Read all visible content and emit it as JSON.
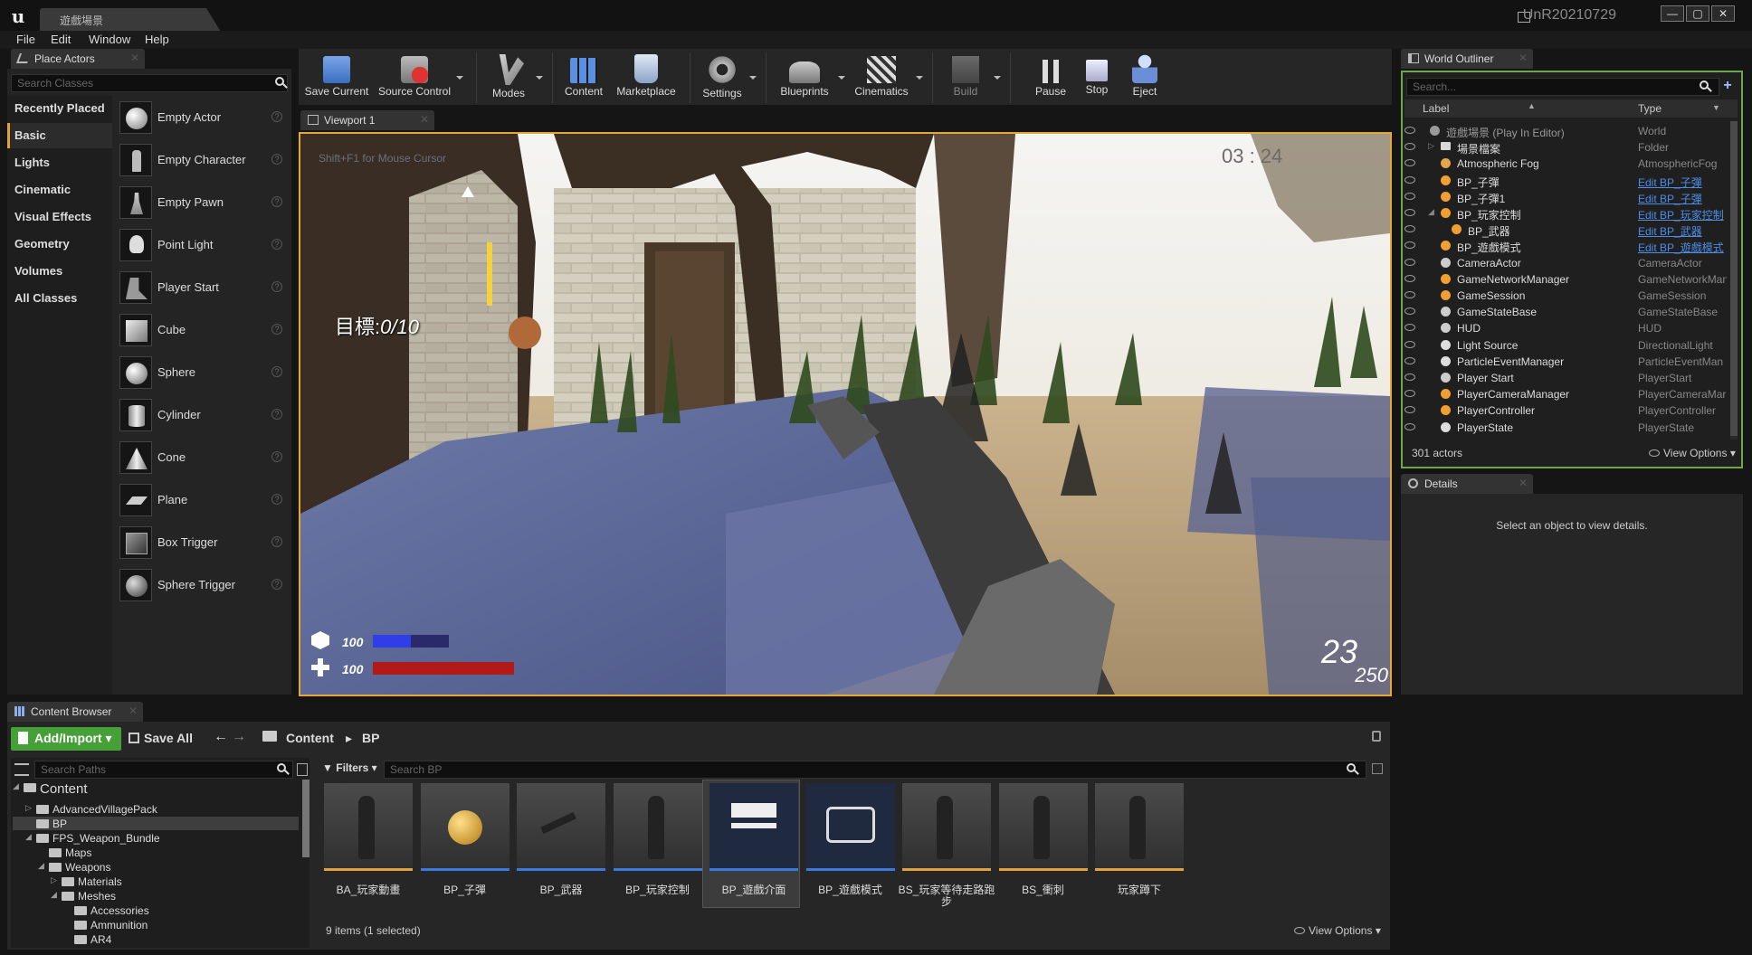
{
  "window": {
    "doc_tab": "遊戲場景",
    "project": "UnR20210729",
    "controls": [
      "—",
      "▢",
      "✕"
    ]
  },
  "menu": [
    "File",
    "Edit",
    "Window",
    "Help"
  ],
  "place_actors": {
    "tab": "Place Actors",
    "search_placeholder": "Search Classes",
    "categories": [
      "Recently Placed",
      "Basic",
      "Lights",
      "Cinematic",
      "Visual Effects",
      "Geometry",
      "Volumes",
      "All Classes"
    ],
    "active_category": "Basic",
    "actors": [
      "Empty Actor",
      "Empty Character",
      "Empty Pawn",
      "Point Light",
      "Player Start",
      "Cube",
      "Sphere",
      "Cylinder",
      "Cone",
      "Plane",
      "Box Trigger",
      "Sphere Trigger"
    ]
  },
  "toolbar": {
    "save_current": "Save Current",
    "source_control": "Source Control",
    "modes": "Modes",
    "content": "Content",
    "marketplace": "Marketplace",
    "settings": "Settings",
    "blueprints": "Blueprints",
    "cinematics": "Cinematics",
    "build": "Build",
    "pause": "Pause",
    "stop": "Stop",
    "eject": "Eject"
  },
  "viewport": {
    "tab": "Viewport 1",
    "hint": "Shift+F1 for Mouse Cursor",
    "timer": "03 : 24",
    "goal_label": "目標:",
    "goal_value": "0/10",
    "armor": "100",
    "health": "100",
    "ammo": "23",
    "ammo_total": "250",
    "armor_fill": 0.5,
    "health_fill": 1.0
  },
  "world_outliner": {
    "tab": "World Outliner",
    "search_placeholder": "Search...",
    "col_label": "Label",
    "col_type": "Type",
    "rows": [
      {
        "label": "遊戲場景 (Play In Editor)",
        "type": "World",
        "link": false,
        "indent": 0,
        "icon": "#9a9a9a"
      },
      {
        "label": "場景檔案",
        "type": "Folder",
        "link": false,
        "indent": 1,
        "icon": "#d8d8d8"
      },
      {
        "label": "Atmospheric Fog",
        "type": "AtmosphericFog",
        "link": false,
        "indent": 1,
        "icon": "#e3a64a"
      },
      {
        "label": "BP_子彈",
        "type": "Edit BP_子彈",
        "link": true,
        "indent": 1,
        "icon": "#f0a030"
      },
      {
        "label": "BP_子彈1",
        "type": "Edit BP_子彈",
        "link": true,
        "indent": 1,
        "icon": "#f0a030"
      },
      {
        "label": "BP_玩家控制",
        "type": "Edit BP_玩家控制",
        "link": true,
        "indent": 1,
        "icon": "#f0a030"
      },
      {
        "label": "BP_武器",
        "type": "Edit BP_武器",
        "link": true,
        "indent": 2,
        "icon": "#f0a030"
      },
      {
        "label": "BP_遊戲模式",
        "type": "Edit BP_遊戲模式",
        "link": true,
        "indent": 1,
        "icon": "#f0a030"
      },
      {
        "label": "CameraActor",
        "type": "CameraActor",
        "link": false,
        "indent": 1,
        "icon": "#cccccc"
      },
      {
        "label": "GameNetworkManager",
        "type": "GameNetworkMan",
        "link": false,
        "indent": 1,
        "icon": "#f0a030"
      },
      {
        "label": "GameSession",
        "type": "GameSession",
        "link": false,
        "indent": 1,
        "icon": "#f0a030"
      },
      {
        "label": "GameStateBase",
        "type": "GameStateBase",
        "link": false,
        "indent": 1,
        "icon": "#cccccc"
      },
      {
        "label": "HUD",
        "type": "HUD",
        "link": false,
        "indent": 1,
        "icon": "#cccccc"
      },
      {
        "label": "Light Source",
        "type": "DirectionalLight",
        "link": false,
        "indent": 1,
        "icon": "#dddddd"
      },
      {
        "label": "ParticleEventManager",
        "type": "ParticleEventMan",
        "link": false,
        "indent": 1,
        "icon": "#dddddd"
      },
      {
        "label": "Player Start",
        "type": "PlayerStart",
        "link": false,
        "indent": 1,
        "icon": "#cccccc"
      },
      {
        "label": "PlayerCameraManager",
        "type": "PlayerCameraMar",
        "link": false,
        "indent": 1,
        "icon": "#f0a030"
      },
      {
        "label": "PlayerController",
        "type": "PlayerController",
        "link": false,
        "indent": 1,
        "icon": "#f0a030"
      },
      {
        "label": "PlayerState",
        "type": "PlayerState",
        "link": false,
        "indent": 1,
        "icon": "#dddddd"
      }
    ],
    "footer": "301 actors",
    "view_options": "View Options"
  },
  "details": {
    "tab": "Details",
    "message": "Select an object to view details."
  },
  "content_browser": {
    "tab": "Content Browser",
    "add_import": "Add/Import",
    "save_all": "Save All",
    "crumb_root": "Content",
    "crumb_leaf": "BP",
    "search_paths_placeholder": "Search Paths",
    "filters": "Filters",
    "search_bp_placeholder": "Search BP",
    "tree": [
      {
        "label": "Content",
        "indent": 0,
        "big": true
      },
      {
        "label": "AdvancedVillagePack",
        "indent": 1
      },
      {
        "label": "BP",
        "indent": 1,
        "selected": true
      },
      {
        "label": "FPS_Weapon_Bundle",
        "indent": 1
      },
      {
        "label": "Maps",
        "indent": 2
      },
      {
        "label": "Weapons",
        "indent": 2
      },
      {
        "label": "Materials",
        "indent": 3
      },
      {
        "label": "Meshes",
        "indent": 3
      },
      {
        "label": "Accessories",
        "indent": 4
      },
      {
        "label": "Ammunition",
        "indent": 4
      },
      {
        "label": "AR4",
        "indent": 4
      }
    ],
    "assets": [
      {
        "name": "BA_玩家動畫",
        "bar": "#e2a13a",
        "kind": "char"
      },
      {
        "name": "BP_子彈",
        "bar": "#3a7adf",
        "kind": "ball"
      },
      {
        "name": "BP_武器",
        "bar": "#3a7adf",
        "kind": "gun"
      },
      {
        "name": "BP_玩家控制",
        "bar": "#3a7adf",
        "kind": "char"
      },
      {
        "name": "BP_遊戲介面",
        "bar": "#3a7adf",
        "kind": "widget"
      },
      {
        "name": "BP_遊戲模式",
        "bar": "#3a7adf",
        "kind": "gamepad"
      },
      {
        "name": "BS_玩家等待走路跑步",
        "bar": "#e2a13a",
        "kind": "char"
      },
      {
        "name": "BS_衝刺",
        "bar": "#e2a13a",
        "kind": "char"
      },
      {
        "name": "玩家蹲下",
        "bar": "#e2a13a",
        "kind": "char"
      }
    ],
    "selected_asset": "BP_遊戲介面",
    "items_count": "9 items (1 selected)",
    "view_options": "View Options"
  }
}
